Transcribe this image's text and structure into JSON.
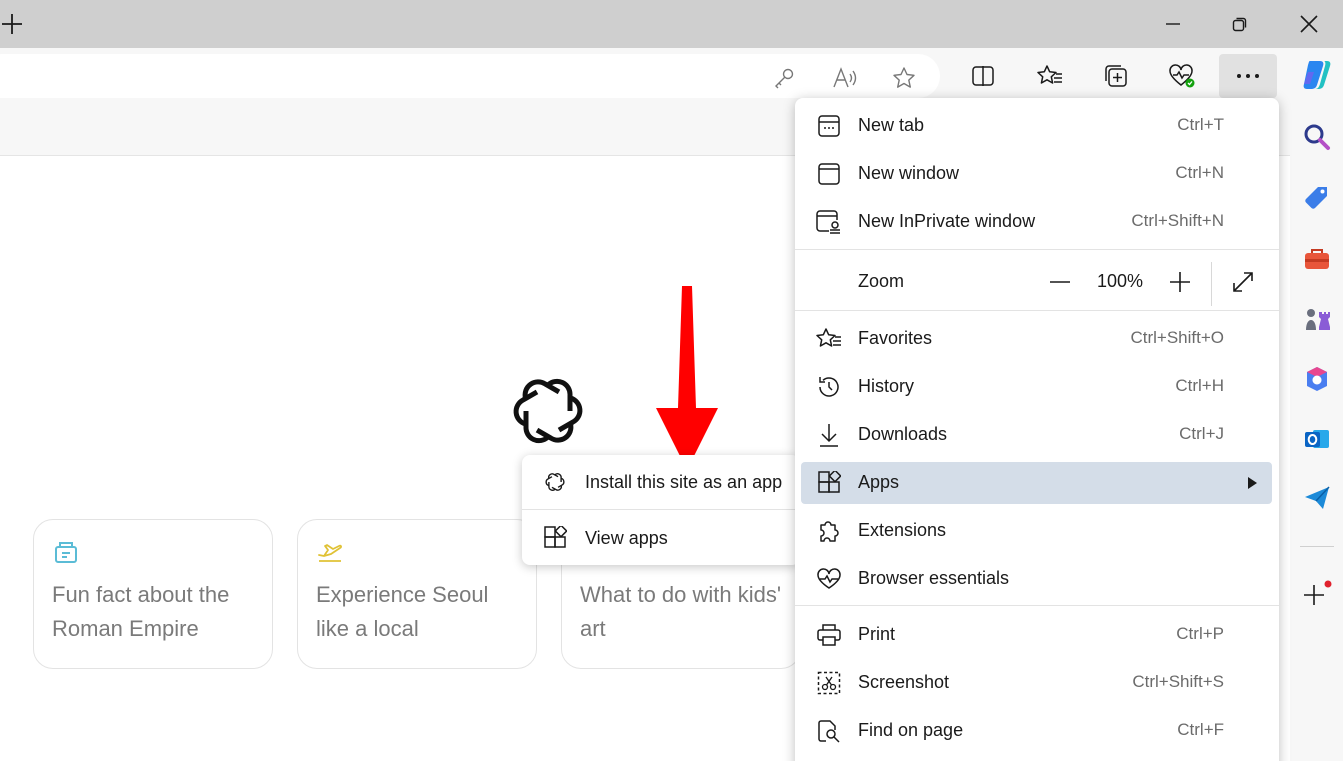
{
  "menu": {
    "items": [
      {
        "label": "New tab",
        "shortcut": "Ctrl+T"
      },
      {
        "label": "New window",
        "shortcut": "Ctrl+N"
      },
      {
        "label": "New InPrivate window",
        "shortcut": "Ctrl+Shift+N"
      },
      {
        "label": "Favorites",
        "shortcut": "Ctrl+Shift+O"
      },
      {
        "label": "History",
        "shortcut": "Ctrl+H"
      },
      {
        "label": "Downloads",
        "shortcut": "Ctrl+J"
      },
      {
        "label": "Apps",
        "shortcut": ""
      },
      {
        "label": "Extensions",
        "shortcut": ""
      },
      {
        "label": "Browser essentials",
        "shortcut": ""
      },
      {
        "label": "Print",
        "shortcut": "Ctrl+P"
      },
      {
        "label": "Screenshot",
        "shortcut": "Ctrl+Shift+S"
      },
      {
        "label": "Find on page",
        "shortcut": "Ctrl+F"
      }
    ],
    "zoom": {
      "label": "Zoom",
      "value": "100%"
    }
  },
  "submenu": {
    "items": [
      {
        "label": "Install this site as an app"
      },
      {
        "label": "View apps"
      }
    ]
  },
  "cards": [
    {
      "text": "Fun fact about the Roman Empire",
      "icon": "scroll-icon",
      "color": "#5bbcd6"
    },
    {
      "text": "Experience Seoul like a local",
      "icon": "plane-icon",
      "color": "#e0c236"
    },
    {
      "text": "What to do with kids' art",
      "icon": "none",
      "color": "#7a7a7a"
    }
  ],
  "colors": {
    "titlebar": "#cfcfcf",
    "toolbar": "#f7f7f7",
    "menu_highlight": "#d4dde8",
    "arrow": "#ff0000"
  }
}
